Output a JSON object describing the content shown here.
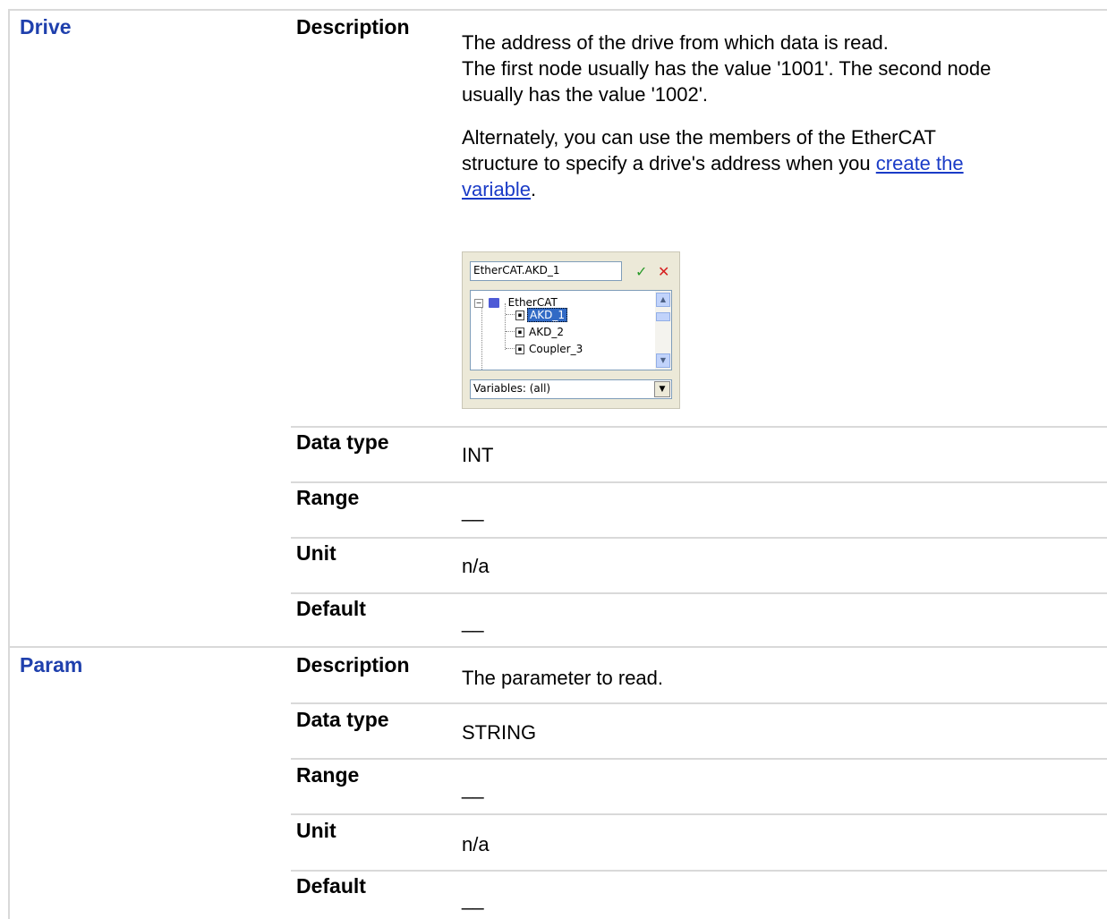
{
  "params": [
    {
      "name": "Drive",
      "description": {
        "line1": "The address of the drive from which data is read.",
        "line2": "The first node usually has the value '1001'. The second node",
        "line3": "usually has the value '1002'.",
        "alt_line1": "Alternately, you can use the members of the EtherCAT",
        "alt_line2_prefix": "structure to specify a drive's address when you ",
        "link_part1": "create the",
        "link_part2": "variable",
        "alt_suffix": "."
      },
      "picker": {
        "input_value": "EtherCAT.AKD_1",
        "tree_root": "EtherCAT",
        "tree_items": [
          "AKD_1",
          "AKD_2",
          "Coupler_3"
        ],
        "selected_item": "AKD_1",
        "filter_value": "Variables: (all)"
      },
      "rows": [
        {
          "label": "Data type",
          "value": "INT"
        },
        {
          "label": "Range",
          "value": "__"
        },
        {
          "label": "Unit",
          "value": "n/a"
        },
        {
          "label": "Default",
          "value": "__"
        }
      ],
      "description_label": "Description"
    },
    {
      "name": "Param",
      "description_label": "Description",
      "description": "The parameter to read.",
      "rows": [
        {
          "label": "Data type",
          "value": "STRING"
        },
        {
          "label": "Range",
          "value": "__"
        },
        {
          "label": "Unit",
          "value": "n/a"
        },
        {
          "label": "Default",
          "value": "__"
        }
      ]
    }
  ]
}
